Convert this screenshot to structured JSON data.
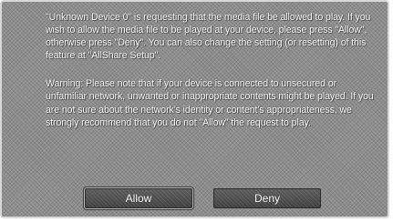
{
  "dialog": {
    "paragraphs": [
      "\"Unknown Device 0\" is requesting that the media file be allowed to play. If you wish to allow the media file to be played at your device, please press \"Allow\", otherwise press \"Deny\". You can also change the setting (or resetting) of this feature at \"AllShare Setup\".",
      "Warning: Please note that if your device is connected to unsecured or unfamiliar network, unwanted or inappropriate contents might be played. If you are not sure about the network's identity or content's appropriateness, we strongly recommend that you do not \"Allow\" the request to play."
    ],
    "allow_label": "Allow",
    "deny_label": "Deny",
    "selected_button": "Allow"
  }
}
